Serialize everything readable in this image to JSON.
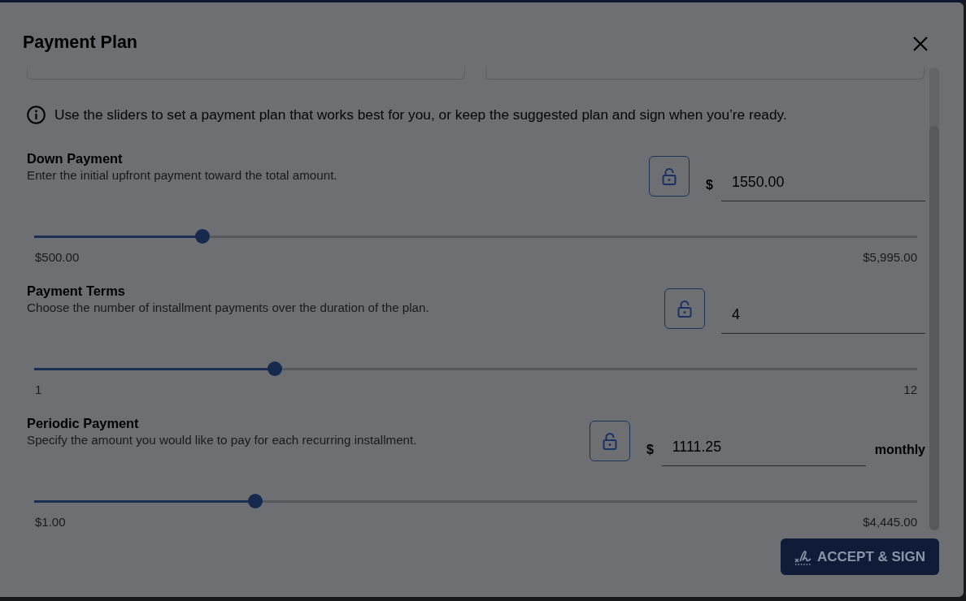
{
  "dialog": {
    "title": "Payment Plan"
  },
  "info": "Use the sliders to set a payment plan that works best for you, or keep the suggested plan and sign when you’re ready.",
  "controls": [
    {
      "title": "Down Payment",
      "description": "Enter the initial upfront payment toward the total amount.",
      "locked": false,
      "prefix": "$",
      "value": "1550.00",
      "level": 0.191,
      "min_label": "$500.00",
      "max_label": "$5,995.00"
    },
    {
      "title": "Payment Terms",
      "description": "Choose the number of installment payments over the duration of the plan.",
      "locked": false,
      "value": "4",
      "level": 0.273,
      "min_label": "1",
      "max_label": "12"
    },
    {
      "title": "Periodic Payment",
      "description": "Specify the amount you would like to pay for each recurring installment.",
      "locked": false,
      "prefix": "$",
      "value": "1111.25",
      "suffix": "monthly",
      "level": 0.25,
      "min_label": "$1.00",
      "max_label": "$4,445.00"
    }
  ],
  "accept_button": "ACCEPT & SIGN"
}
